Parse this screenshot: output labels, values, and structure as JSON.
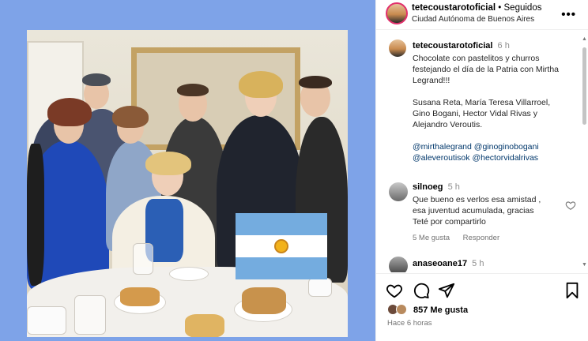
{
  "post": {
    "header": {
      "username": "tetecoustarotoficial",
      "separator": "•",
      "follow_status": "Seguidos",
      "location": "Ciudad Autónoma de Buenos Aires",
      "more_icon": "more-options-icon"
    },
    "caption": {
      "username": "tetecoustarotoficial",
      "time": "6 h",
      "line1": "Chocolate con pastelitos y churros festejando el día de la Patria con Mirtha Legrand!!!",
      "line2": "Susana Reta, María Teresa Villarroel, Gino Bogani, Hector Vidal Rivas y Alejandro Veroutis.",
      "mentions": [
        "@mirthalegrand",
        "@ginoginobogani",
        "@aleveroutisok",
        "@hectorvidalrivas"
      ]
    },
    "comments": [
      {
        "username": "silnoeg",
        "time": "5 h",
        "text": "Que bueno es verlos esa amistad , esa juventud acumulada, gracias Teté por compartirlo",
        "likes": "5 Me gusta",
        "reply": "Responder"
      },
      {
        "username": "anaseoane17",
        "time": "5 h"
      }
    ],
    "actions": {
      "like_icon": "heart-icon",
      "comment_icon": "comment-icon",
      "share_icon": "share-icon",
      "save_icon": "bookmark-icon"
    },
    "likes_count": "857 Me gusta",
    "posted_ago": "Hace 6 horas"
  },
  "colors": {
    "media_background": "#7ea3e8",
    "mention": "#00376b",
    "muted": "#737373",
    "story_ring": "#e1306c",
    "flag_blue": "#74acdf"
  }
}
